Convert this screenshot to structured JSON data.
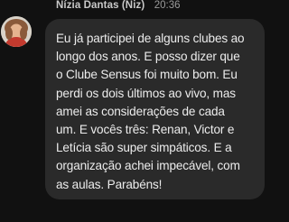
{
  "message": {
    "sender_name": "Nízia Dantas (Niz)",
    "timestamp": "20:36",
    "text": "Eu já participei de alguns clubes ao\nlongo dos anos. E posso dizer que\no Clube Sensus foi muito bom. Eu\nperdi os dois últimos ao vivo, mas\namei as considerações de cada\num. E vocês três: Renan, Victor e\nLetícia são super simpáticos. E a\norganização achei impecável, com\nas aulas. Parabéns!"
  }
}
